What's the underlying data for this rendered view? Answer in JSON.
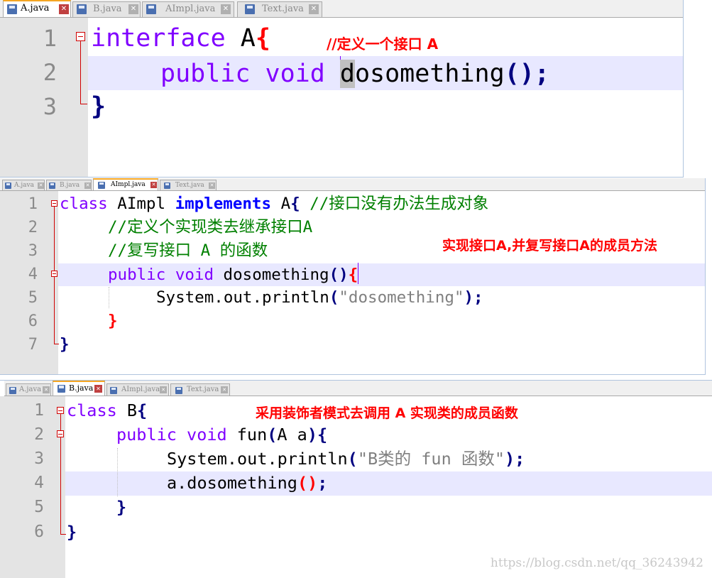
{
  "panel1": {
    "tabs": [
      "A.java",
      "B.java",
      "AImpl.java",
      "Text.java"
    ],
    "active_tab": "A.java",
    "lines": [
      "1",
      "2",
      "3"
    ],
    "code": {
      "l1_kw": "interface",
      "l1_rest": " A",
      "l1_brace": "{",
      "l2_public": "public",
      "l2_void": "void",
      "l2_sel": "d",
      "l2_name": "osomething",
      "l2_paren": "()",
      "l2_semi": ";",
      "l3_brace": "}"
    },
    "annotation": "//定义一个接口 A"
  },
  "panel2": {
    "tabs": [
      "A.java",
      "B.java",
      "AImpl.java",
      "Text.java"
    ],
    "active_tab": "AImpl.java",
    "lines": [
      "1",
      "2",
      "3",
      "4",
      "5",
      "6",
      "7"
    ],
    "code": {
      "l1_class": "class",
      "l1_name": " AImpl ",
      "l1_impl": "implements",
      "l1_iface": " A",
      "l1_brace": "{",
      "l1_comment": " //接口没有办法生成对象",
      "l2_comment": "//定义个实现类去继承接口A",
      "l3_comment": "//复写接口 A 的函数",
      "l4_public": "public",
      "l4_void": "void",
      "l4_name": " dosomething",
      "l4_paren": "()",
      "l4_brace": "{",
      "l5_call": "System.out.println",
      "l5_open": "(",
      "l5_str": "\"dosomething\"",
      "l5_close": ")",
      "l5_semi": ";",
      "l6_brace": "}",
      "l7_brace": "}"
    },
    "annotation": "实现接口A,并复写接口A的成员方法"
  },
  "panel3": {
    "tabs": [
      "A.java",
      "B.java",
      "AImpl.java",
      "Text.java"
    ],
    "active_tab": "B.java",
    "lines": [
      "1",
      "2",
      "3",
      "4",
      "5",
      "6"
    ],
    "code": {
      "l1_class": "class",
      "l1_name": " B",
      "l1_brace": "{",
      "l2_public": "public",
      "l2_void": "void",
      "l2_name": " fun",
      "l2_open": "(",
      "l2_args": "A a",
      "l2_close": ")",
      "l2_brace": "{",
      "l3_call": "System.out.println",
      "l3_open": "(",
      "l3_str": "\"B类的 fun 函数\"",
      "l3_close": ")",
      "l3_semi": ";",
      "l4_call": "a.dosomething",
      "l4_paren": "()",
      "l4_semi": ";",
      "l5_brace": "}",
      "l6_brace": "}"
    },
    "annotation": "采用装饰者模式去调用 A 实现类的成员函数"
  },
  "watermark": "https://blog.csdn.net/qq_36243942",
  "colors": {
    "keyword": "#8000ff",
    "bold_keyword": "#0000ff",
    "operator": "#000080",
    "brace": "#ff0000",
    "comment": "#008000",
    "string": "#808080",
    "annotation": "#ff0000",
    "current_line": "#e8e8ff"
  }
}
